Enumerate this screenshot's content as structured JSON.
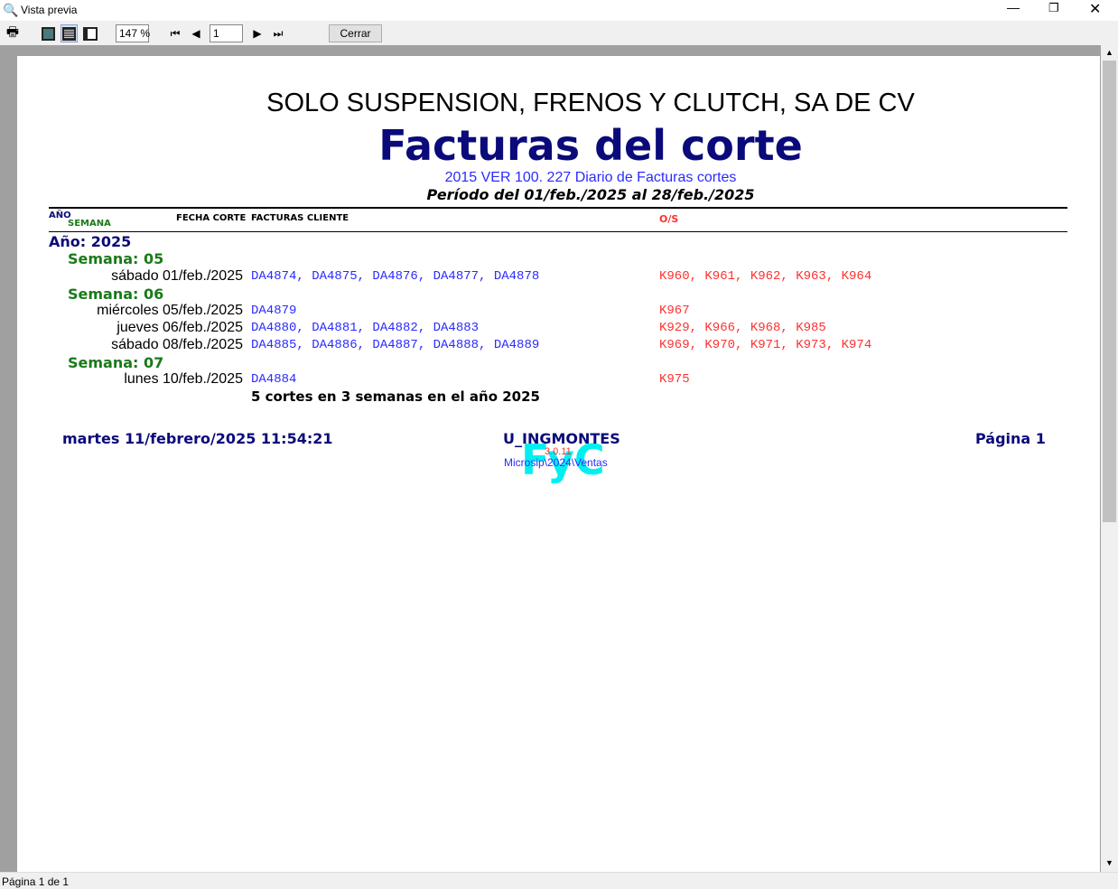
{
  "window": {
    "title": "Vista previa",
    "icon": "print-preview-icon"
  },
  "toolbar": {
    "zoom": "147 %",
    "page_input": "1",
    "close_label": "Cerrar"
  },
  "report": {
    "company": "SOLO SUSPENSION, FRENOS Y CLUTCH, SA DE CV",
    "title": "Facturas del corte",
    "subtitle": "2015 VER 100. 227 Diario de Facturas cortes",
    "period": "Período del 01/feb./2025 al 28/feb./2025",
    "headers": {
      "year": "AÑO",
      "week": "SEMANA",
      "date": "FECHA CORTE",
      "invoices": "FACTURAS CLIENTE",
      "os": "O/S"
    },
    "year_label": "Año: 2025",
    "weeks": [
      {
        "label": "Semana: 05",
        "rows": [
          {
            "date": "sábado 01/feb./2025",
            "invoices": "DA4874, DA4875, DA4876, DA4877, DA4878",
            "os": "K960, K961, K962, K963, K964"
          }
        ]
      },
      {
        "label": "Semana: 06",
        "rows": [
          {
            "date": "miércoles 05/feb./2025",
            "invoices": "DA4879",
            "os": "K967"
          },
          {
            "date": "jueves 06/feb./2025",
            "invoices": "DA4880, DA4881, DA4882, DA4883",
            "os": "K929, K966, K968, K985"
          },
          {
            "date": "sábado 08/feb./2025",
            "invoices": "DA4885, DA4886, DA4887, DA4888, DA4889",
            "os": "K969, K970, K971, K973, K974"
          }
        ]
      },
      {
        "label": "Semana: 07",
        "rows": [
          {
            "date": "lunes 10/feb./2025",
            "invoices": "DA4884",
            "os": "K975"
          }
        ]
      }
    ],
    "summary": "5 cortes en 3 semanas en el año 2025",
    "footer": {
      "datetime": "martes 11/febrero/2025 11:54:21",
      "user": "U_INGMONTES",
      "version": "3.0.11",
      "path": "Microsip\\2024\\Ventas",
      "logo": "FyC",
      "page": "Página 1"
    }
  },
  "status": {
    "text": "Página 1 de 1"
  }
}
